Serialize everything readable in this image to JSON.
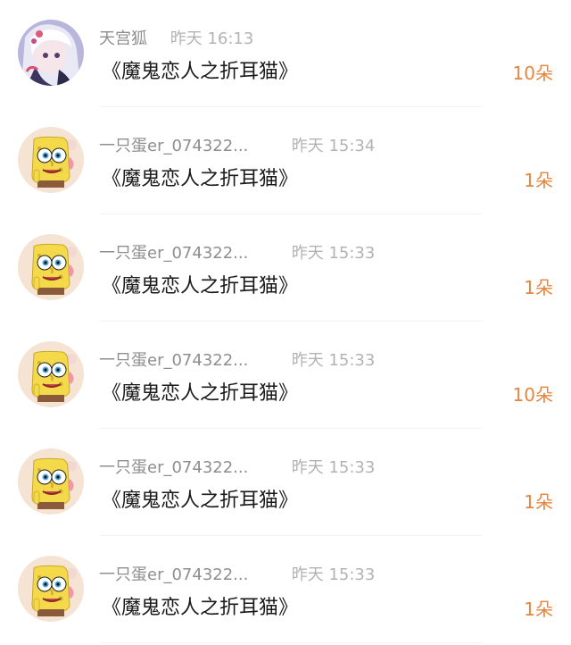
{
  "gifts": [
    {
      "username": "天宫狐",
      "time": "昨天 16:13",
      "title": "《魔鬼恋人之折耳猫》",
      "amount": "10朵",
      "avatar": "anime-character-avatar"
    },
    {
      "username": "一只蛋er_074322...",
      "time": "昨天 15:34",
      "title": "《魔鬼恋人之折耳猫》",
      "amount": "1朵",
      "avatar": "spongebob-avatar"
    },
    {
      "username": "一只蛋er_074322...",
      "time": "昨天 15:33",
      "title": "《魔鬼恋人之折耳猫》",
      "amount": "1朵",
      "avatar": "spongebob-avatar"
    },
    {
      "username": "一只蛋er_074322...",
      "time": "昨天 15:33",
      "title": "《魔鬼恋人之折耳猫》",
      "amount": "10朵",
      "avatar": "spongebob-avatar"
    },
    {
      "username": "一只蛋er_074322...",
      "time": "昨天 15:33",
      "title": "《魔鬼恋人之折耳猫》",
      "amount": "1朵",
      "avatar": "spongebob-avatar"
    },
    {
      "username": "一只蛋er_074322...",
      "time": "昨天 15:33",
      "title": "《魔鬼恋人之折耳猫》",
      "amount": "1朵",
      "avatar": "spongebob-avatar"
    }
  ],
  "colors": {
    "amount": "#e8843c",
    "title": "#1a1a1a",
    "meta": "#999999",
    "divider": "#f2f2f2"
  }
}
